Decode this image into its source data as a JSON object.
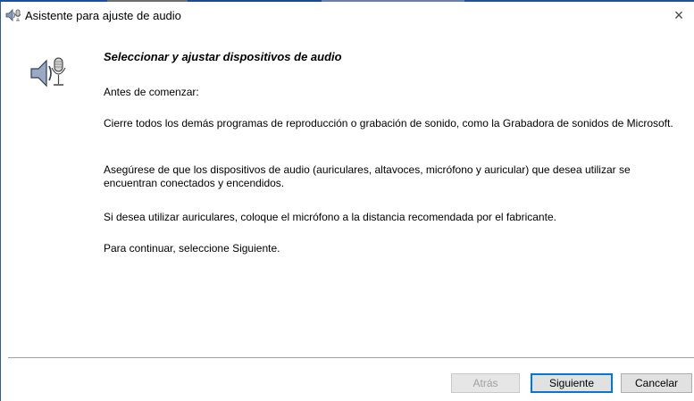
{
  "window": {
    "title": "Asistente para ajuste de audio",
    "close_glyph": "×",
    "icon": "speaker-microphone-icon",
    "accent_color": "#2b5aa8"
  },
  "content": {
    "heading": "Seleccionar y ajustar dispositivos de audio",
    "intro": "Antes de comenzar:",
    "paragraphs": [
      "Cierre todos los demás programas de reproducción o grabación de sonido, como la Grabadora de sonidos de Microsoft.",
      "Asegúrese de que los dispositivos de audio (auriculares, altavoces, micrófono y auricular) que desea utilizar se encuentran conectados y encendidos.",
      "Si desea utilizar auriculares, coloque el micrófono a la distancia recomendada por el fabricante.",
      "Para continuar, seleccione Siguiente."
    ]
  },
  "buttons": {
    "back": "Atrás",
    "next": "Siguiente",
    "cancel": "Cancelar"
  }
}
